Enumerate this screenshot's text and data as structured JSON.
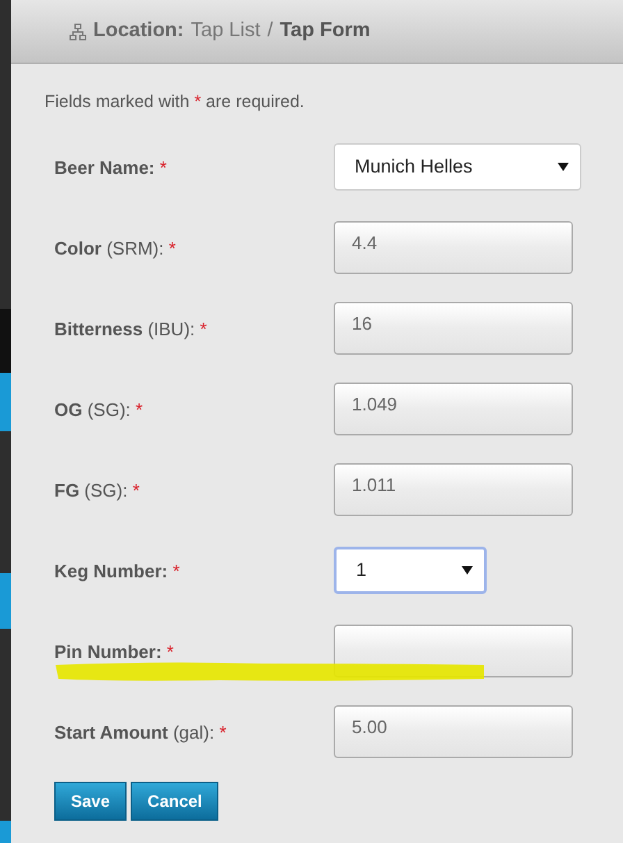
{
  "breadcrumb": {
    "label": "Location:",
    "items": [
      {
        "text": "Tap List",
        "current": false
      },
      {
        "text": "/",
        "current": false
      },
      {
        "text": "Tap Form",
        "current": true
      }
    ]
  },
  "note": "Fields marked with * are required.",
  "fields": [
    {
      "kind": "select",
      "label": "**Beer Name:**",
      "required": "*",
      "value": "Munich Helles",
      "focused": false,
      "highlighted": false
    },
    {
      "kind": "input",
      "label": "**Color** (SRM):",
      "required": "*",
      "value": "4.4",
      "disabled": true,
      "highlighted": false
    },
    {
      "kind": "input",
      "label": "**Bitterness** (IBU):",
      "required": "*",
      "value": "16",
      "disabled": true,
      "highlighted": false
    },
    {
      "kind": "input",
      "label": "**OG** (SG):",
      "required": "*",
      "value": "1.049",
      "disabled": true,
      "highlighted": false
    },
    {
      "kind": "input",
      "label": "**FG** (SG):",
      "required": "*",
      "value": "1.011",
      "disabled": true,
      "highlighted": false
    },
    {
      "kind": "select",
      "label": "**Keg Number:**",
      "required": "*",
      "value": "1",
      "focused": true,
      "highlighted": false
    },
    {
      "kind": "input",
      "label": "**Pin Number:**",
      "required": "*",
      "disabled": true,
      "highlighted": true
    },
    {
      "kind": "input",
      "label": "**Start Amount** (gal):",
      "required": "*",
      "value": "5.00",
      "disabled": true,
      "highlighted": false
    }
  ],
  "buttons": [
    "Save",
    "Cancel"
  ]
}
